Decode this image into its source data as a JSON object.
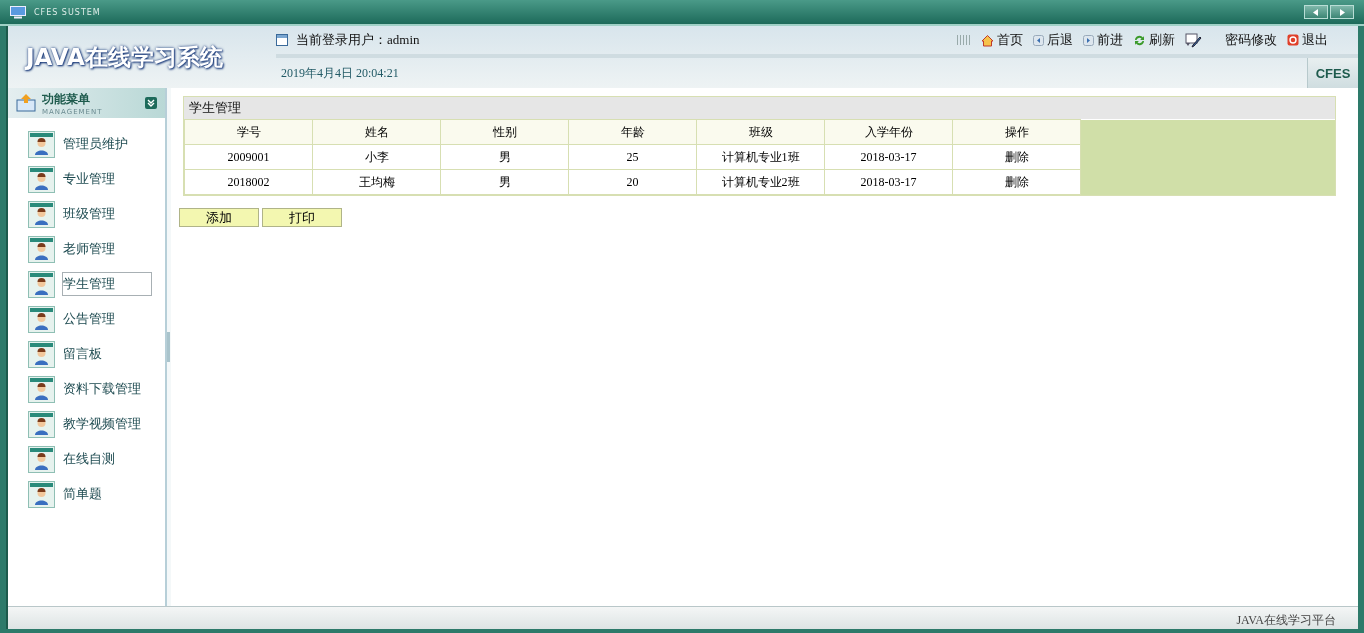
{
  "window": {
    "title": "CFES SUSTEM"
  },
  "header": {
    "app_title": "JAVA在线学习系统",
    "user_label": "当前登录用户：",
    "user": "admin",
    "datetime": "2019年4月4日  20:04:21",
    "badge": "CFES"
  },
  "toolbar": [
    {
      "kind": "home",
      "label": "首页"
    },
    {
      "kind": "back",
      "label": "后退"
    },
    {
      "kind": "forward",
      "label": "前进"
    },
    {
      "kind": "refresh",
      "label": "刷新"
    },
    {
      "kind": "edit",
      "label": "密码修改"
    },
    {
      "kind": "exit",
      "label": "退出"
    }
  ],
  "sidebar": {
    "title": "功能菜单",
    "subtitle": "MANAGEMENT",
    "items": [
      {
        "label": "管理员维护",
        "selected": false
      },
      {
        "label": "专业管理",
        "selected": false
      },
      {
        "label": "班级管理",
        "selected": false
      },
      {
        "label": "老师管理",
        "selected": false
      },
      {
        "label": "学生管理",
        "selected": true
      },
      {
        "label": "公告管理",
        "selected": false
      },
      {
        "label": "留言板",
        "selected": false
      },
      {
        "label": "资料下载管理",
        "selected": false
      },
      {
        "label": "教学视频管理",
        "selected": false
      },
      {
        "label": "在线自测",
        "selected": false
      },
      {
        "label": "简单题",
        "selected": false
      }
    ]
  },
  "panel": {
    "title": "学生管理"
  },
  "table": {
    "columns": [
      "学号",
      "姓名",
      "性别",
      "年龄",
      "班级",
      "入学年份",
      "操作"
    ],
    "rows": [
      [
        "2009001",
        "小李",
        "男",
        "25",
        "计算机专业1班",
        "2018-03-17",
        "删除"
      ],
      [
        "2018002",
        "王均梅",
        "男",
        "20",
        "计算机专业2班",
        "2018-03-17",
        "删除"
      ]
    ]
  },
  "buttons": [
    "添加",
    "打印"
  ],
  "status_bar": {
    "text": "JAVA在线学习平台"
  }
}
